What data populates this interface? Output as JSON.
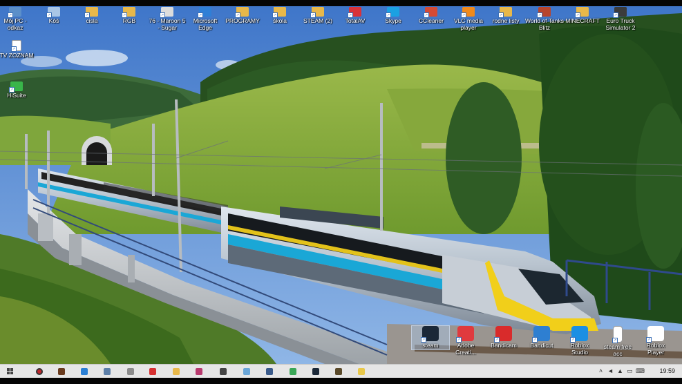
{
  "desktop": {
    "icons_row1": [
      {
        "label": "Môj PC - odkaz",
        "icon": "computer-icon",
        "color": "#5b8fc9"
      },
      {
        "label": "Kôš",
        "icon": "recycle-bin-icon",
        "color": "#a9c6e6"
      },
      {
        "label": "cisla",
        "icon": "folder-icon",
        "color": "#e8b84a"
      },
      {
        "label": "RGB",
        "icon": "folder-icon",
        "color": "#e8b84a"
      },
      {
        "label": "76 - Maroon 5 - Sugar",
        "icon": "video-file-icon",
        "color": "#dcdcdc"
      },
      {
        "label": "Microsoft Edge",
        "icon": "edge-icon",
        "color": "#2f7fd6"
      },
      {
        "label": "PROGRAMY",
        "icon": "folder-icon",
        "color": "#e8b84a"
      },
      {
        "label": "škola",
        "icon": "folder-icon",
        "color": "#e8b84a"
      },
      {
        "label": "STEAM (2)",
        "icon": "folder-icon",
        "color": "#e8b84a"
      },
      {
        "label": "TotalAV",
        "icon": "totalav-icon",
        "color": "#d9323a"
      },
      {
        "label": "Skype",
        "icon": "skype-icon",
        "color": "#1ba1e2"
      },
      {
        "label": "CCleaner",
        "icon": "ccleaner-icon",
        "color": "#d44a36"
      },
      {
        "label": "VLC media player",
        "icon": "vlc-icon",
        "color": "#f08a1c"
      },
      {
        "label": "rodne listy",
        "icon": "folder-icon",
        "color": "#e8b84a"
      },
      {
        "label": "World of Tanks Blitz",
        "icon": "wot-blitz-icon",
        "color": "#b8442c"
      },
      {
        "label": "MINECRAFT",
        "icon": "folder-icon",
        "color": "#e8b84a"
      },
      {
        "label": "Euro Truck Simulator 2",
        "icon": "ets2-icon",
        "color": "#3b3b3b"
      }
    ],
    "icons_col1": [
      {
        "label": "TV ZOZNAM",
        "icon": "text-file-icon",
        "color": "#ffffff"
      },
      {
        "label": "HiSuite",
        "icon": "hisuite-icon",
        "color": "#39b54a"
      }
    ],
    "icons_bottom": [
      {
        "label": "steam",
        "icon": "steam-icon",
        "color": "#1b2838"
      },
      {
        "label": "Adobe Creati...",
        "icon": "adobe-cc-icon",
        "color": "#e03a3e"
      },
      {
        "label": "Bandicam",
        "icon": "bandicam-icon",
        "color": "#d92b2b"
      },
      {
        "label": "Bandicut",
        "icon": "bandicut-icon",
        "color": "#2e7fd1"
      },
      {
        "label": "Roblox Studio",
        "icon": "roblox-studio-icon",
        "color": "#1a8fe3"
      },
      {
        "label": "steam free acc",
        "icon": "text-file-icon",
        "color": "#ffffff"
      },
      {
        "label": "Roblox Player",
        "icon": "roblox-player-icon",
        "color": "#ffffff"
      }
    ]
  },
  "taskbar": {
    "start_label": "Start",
    "pinned": [
      {
        "icon": "record-icon",
        "color": "#c0262b"
      },
      {
        "icon": "app-icon",
        "color": "#6a3b1e"
      },
      {
        "icon": "pen-icon",
        "color": "#2a7fd4"
      },
      {
        "icon": "printer-icon",
        "color": "#5d7fa8"
      },
      {
        "icon": "drive-icon",
        "color": "#8c8c8c"
      },
      {
        "icon": "pdf-icon",
        "color": "#d63030"
      },
      {
        "icon": "folder-icon",
        "color": "#e8b84a"
      },
      {
        "icon": "paint-icon",
        "color": "#b83a6e"
      },
      {
        "icon": "settings-icon",
        "color": "#444444"
      },
      {
        "icon": "notepad-icon",
        "color": "#6aa6d8"
      },
      {
        "icon": "game-icon",
        "color": "#3a5a8a"
      },
      {
        "icon": "chrome-icon",
        "color": "#3aa757"
      },
      {
        "icon": "steam-icon",
        "color": "#1b2838"
      },
      {
        "icon": "minecraft-icon",
        "color": "#5a4a2a"
      },
      {
        "icon": "notes-icon",
        "color": "#e8c84a"
      }
    ],
    "tray_icons": [
      "chevron-up-icon",
      "volume-icon",
      "network-icon",
      "battery-icon",
      "keyboard-icon"
    ],
    "clock": "19:59"
  }
}
